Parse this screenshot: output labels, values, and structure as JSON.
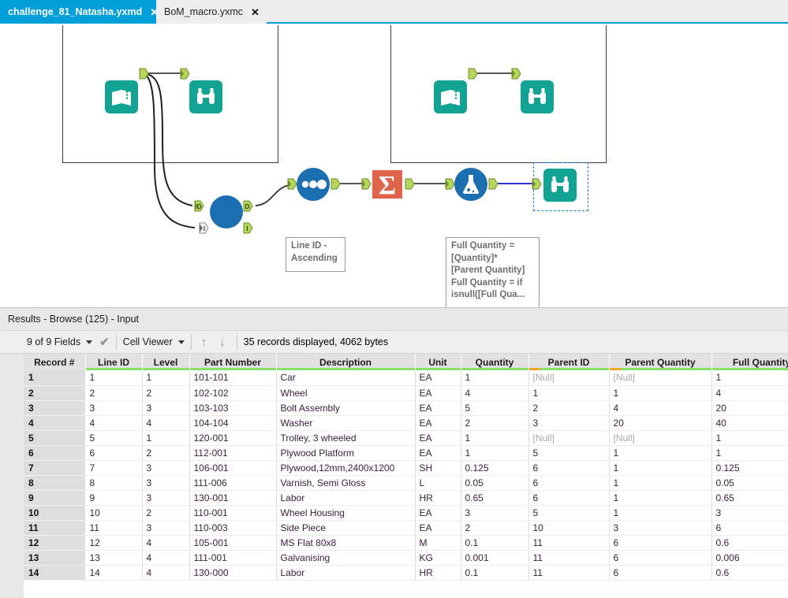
{
  "tabs": [
    {
      "label": "challenge_81_Natasha.yxmd",
      "close": "✕",
      "active": true
    },
    {
      "label": "BoM_macro.yxmc",
      "close": "✕",
      "active": false
    }
  ],
  "canvas": {
    "tools": [
      {
        "id": "input-left",
        "icon": "text-input-icon"
      },
      {
        "id": "browse-left",
        "icon": "browse-binoculars-icon"
      },
      {
        "id": "input-right",
        "icon": "text-input-icon"
      },
      {
        "id": "browse-right",
        "icon": "browse-binoculars-icon"
      },
      {
        "id": "macro",
        "icon": "macro-circle-icon"
      },
      {
        "id": "sort",
        "icon": "sort-three-dots-icon"
      },
      {
        "id": "summarize",
        "icon": "summarize-sigma-icon"
      },
      {
        "id": "formula",
        "icon": "formula-flask-icon"
      },
      {
        "id": "browse-final",
        "icon": "browse-binoculars-icon"
      }
    ],
    "annotations": {
      "sort": "Line ID -\nAscending",
      "formula": "Full Quantity =\n[Quantity]*\n[Parent Quantity]\nFull Quantity = if\nisnull([Full Qua..."
    },
    "port_labels": {
      "d": "D",
      "i": "I"
    }
  },
  "results": {
    "title": "Results - Browse (125) - Input",
    "toolbar": {
      "fields_label": "9 of 9 Fields",
      "checkmark": "✔",
      "viewer_label": "Cell Viewer",
      "sort_asc": "↑",
      "sort_desc": "↓",
      "status": "35 records displayed, 4062 bytes",
      "list_icon": "list-icon",
      "browse_icon": "browse-binoculars-icon"
    },
    "grid": {
      "columns": [
        {
          "label": "Record #",
          "bar": "none"
        },
        {
          "label": "Line ID",
          "bar": "ok"
        },
        {
          "label": "Level",
          "bar": "ok"
        },
        {
          "label": "Part Number",
          "bar": "ok"
        },
        {
          "label": "Description",
          "bar": "ok"
        },
        {
          "label": "Unit",
          "bar": "ok"
        },
        {
          "label": "Quantity",
          "bar": "ok"
        },
        {
          "label": "Parent ID",
          "bar": "null-ok"
        },
        {
          "label": "Parent Quantity",
          "bar": "null-ok"
        },
        {
          "label": "Full Quantity",
          "bar": "ok"
        }
      ],
      "rows": [
        [
          "1",
          "1",
          "1",
          "101-101",
          "Car",
          "EA",
          "1",
          "[Null]",
          "[Null]",
          "1"
        ],
        [
          "2",
          "2",
          "2",
          "102-102",
          "Wheel",
          "EA",
          "4",
          "1",
          "1",
          "4"
        ],
        [
          "3",
          "3",
          "3",
          "103-103",
          "Bolt Assembly",
          "EA",
          "5",
          "2",
          "4",
          "20"
        ],
        [
          "4",
          "4",
          "4",
          "104-104",
          "Washer",
          "EA",
          "2",
          "3",
          "20",
          "40"
        ],
        [
          "5",
          "5",
          "1",
          "120-001",
          "Trolley, 3 wheeled",
          "EA",
          "1",
          "[Null]",
          "[Null]",
          "1"
        ],
        [
          "6",
          "6",
          "2",
          "112-001",
          "Plywood Platform",
          "EA",
          "1",
          "5",
          "1",
          "1"
        ],
        [
          "7",
          "7",
          "3",
          "106-001",
          "Plywood,12mm,2400x1200",
          "SH",
          "0.125",
          "6",
          "1",
          "0.125"
        ],
        [
          "8",
          "8",
          "3",
          "111-006",
          "Varnish, Semi Gloss",
          "L",
          "0.05",
          "6",
          "1",
          "0.05"
        ],
        [
          "9",
          "9",
          "3",
          "130-001",
          "Labor",
          "HR",
          "0.65",
          "6",
          "1",
          "0.65"
        ],
        [
          "10",
          "10",
          "2",
          "110-001",
          "Wheel Housing",
          "EA",
          "3",
          "5",
          "1",
          "3"
        ],
        [
          "11",
          "11",
          "3",
          "110-003",
          "Side Piece",
          "EA",
          "2",
          "10",
          "3",
          "6"
        ],
        [
          "12",
          "12",
          "4",
          "105-001",
          "MS Flat 80x8",
          "M",
          "0.1",
          "11",
          "6",
          "0.6"
        ],
        [
          "13",
          "13",
          "4",
          "111-001",
          "Galvanising",
          "KG",
          "0.001",
          "11",
          "6",
          "0.006"
        ],
        [
          "14",
          "14",
          "4",
          "130-000",
          "Labor",
          "HR",
          "0.1",
          "11",
          "6",
          "0.6"
        ]
      ]
    }
  },
  "colors": {
    "tab_active": "#009fd9",
    "tool_teal": "#13a394",
    "tool_blue": "#1b6eb0",
    "tool_orange": "#e06449",
    "port_green": "#b5d65b",
    "bar_green": "#8ade6b",
    "bar_orange": "#f0a81e"
  }
}
